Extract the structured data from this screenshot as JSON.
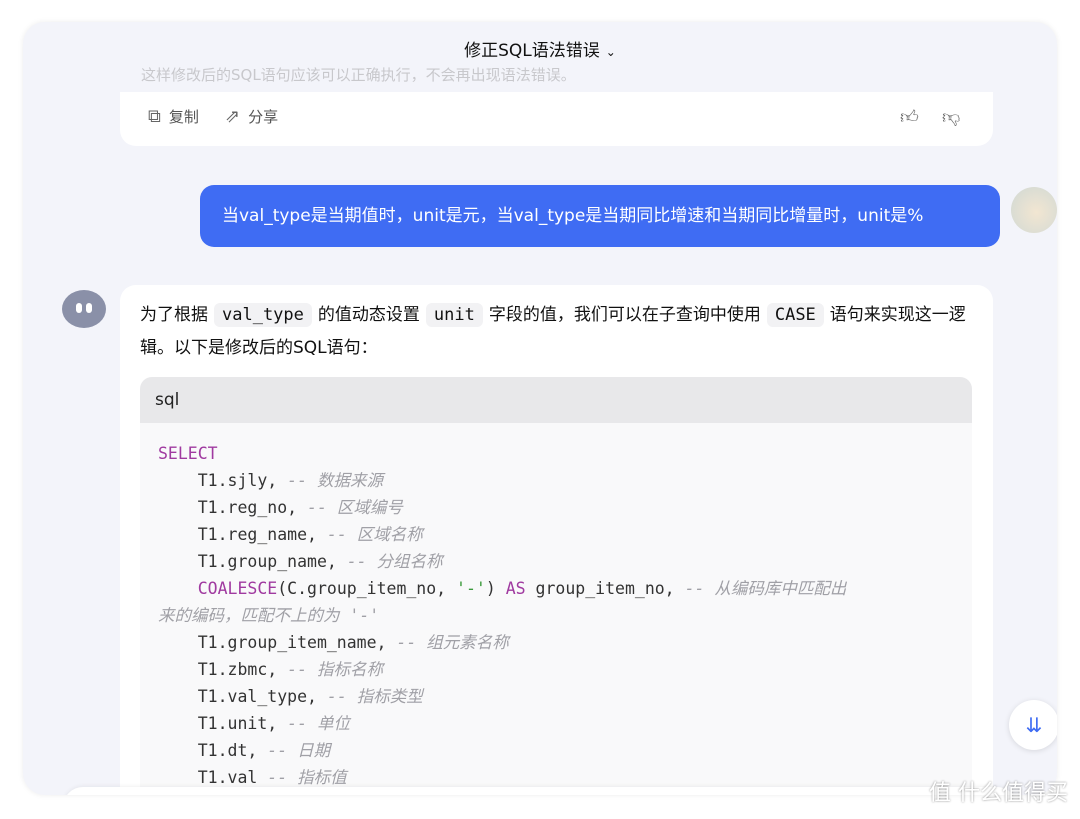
{
  "header": {
    "title": "修正SQL语法错误"
  },
  "prev_message": {
    "faded_text": "这样修改后的SQL语句应该可以正确执行，不会再出现语法错误。",
    "copy_label": "复制",
    "share_label": "分享"
  },
  "user_message": {
    "text": "当val_type是当期值时，unit是元，当val_type是当期同比增速和当期同比增量时，unit是%"
  },
  "reply": {
    "intro_parts": [
      "为了根据",
      "val_type",
      "的值动态设置",
      "unit",
      "字段的值，我们可以在子查询中使用",
      "CASE",
      "语句来实现这一逻辑。以下是修改后的SQL语句："
    ],
    "code_lang": "sql",
    "code_lines": [
      [
        [
          "kw",
          "SELECT"
        ]
      ],
      [
        [
          "",
          "    T1.sjly, "
        ],
        [
          "cm",
          "-- 数据来源"
        ]
      ],
      [
        [
          "",
          "    T1.reg_no, "
        ],
        [
          "cm",
          "-- 区域编号"
        ]
      ],
      [
        [
          "",
          "    T1.reg_name, "
        ],
        [
          "cm",
          "-- 区域名称"
        ]
      ],
      [
        [
          "",
          "    T1.group_name, "
        ],
        [
          "cm",
          "-- 分组名称"
        ]
      ],
      [
        [
          "",
          "    "
        ],
        [
          "kw",
          "COALESCE"
        ],
        [
          "",
          "(C.group_item_no, "
        ],
        [
          "str",
          "'-'"
        ],
        [
          "",
          ") "
        ],
        [
          "kw",
          "AS"
        ],
        [
          "",
          " group_item_no, "
        ],
        [
          "cm",
          "-- 从编码库中匹配出"
        ]
      ],
      [
        [
          "cm",
          "来的编码，匹配不上的为 '-'"
        ]
      ],
      [
        [
          "",
          "    T1.group_item_name, "
        ],
        [
          "cm",
          "-- 组元素名称"
        ]
      ],
      [
        [
          "",
          "    T1.zbmc, "
        ],
        [
          "cm",
          "-- 指标名称"
        ]
      ],
      [
        [
          "",
          "    T1.val_type, "
        ],
        [
          "cm",
          "-- 指标类型"
        ]
      ],
      [
        [
          "",
          "    T1.unit, "
        ],
        [
          "cm",
          "-- 单位"
        ]
      ],
      [
        [
          "",
          "    T1.dt, "
        ],
        [
          "cm",
          "-- 日期"
        ]
      ],
      [
        [
          "",
          "    T1.val "
        ],
        [
          "cm",
          "-- 指标值"
        ]
      ]
    ]
  },
  "watermark": "值 什么值得买",
  "colors": {
    "accent": "#3f6cf3",
    "keyword": "#a03aa0",
    "string": "#3a9a3a",
    "comment": "#a0a0a6"
  }
}
